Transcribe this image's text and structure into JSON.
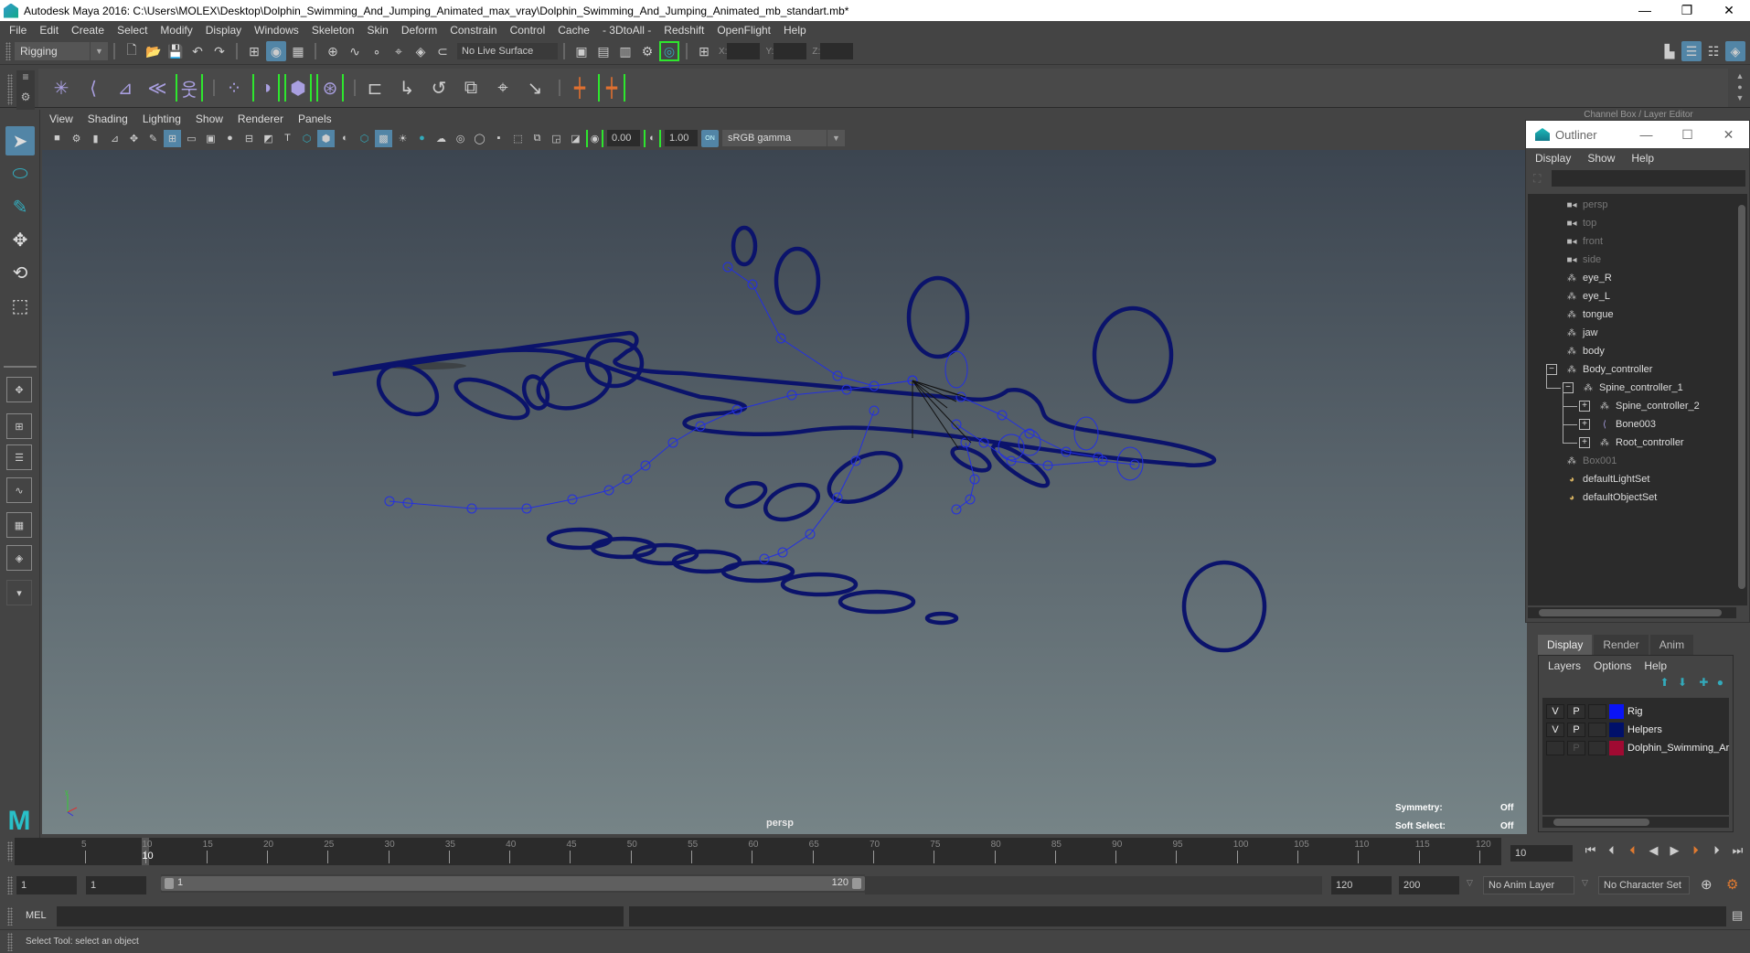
{
  "window": {
    "title": "Autodesk Maya 2016: C:\\Users\\MOLEX\\Desktop\\Dolphin_Swimming_And_Jumping_Animated_max_vray\\Dolphin_Swimming_And_Jumping_Animated_mb_standart.mb*",
    "minimize": "—",
    "restore": "❐",
    "close": "✕"
  },
  "menubar": [
    "File",
    "Edit",
    "Create",
    "Select",
    "Modify",
    "Display",
    "Windows",
    "Skeleton",
    "Skin",
    "Deform",
    "Constrain",
    "Control",
    "Cache",
    "- 3DtoAll -",
    "Redshift",
    "OpenFlight",
    "Help"
  ],
  "statusline": {
    "menuset": "Rigging",
    "live_surface": "No Live Surface",
    "x_label": "X:",
    "y_label": "Y:",
    "z_label": "Z:",
    "x_value": "",
    "y_value": "",
    "z_value": ""
  },
  "shelf": {
    "tools": [
      "joint-tool",
      "ik-handle",
      "ik-spline",
      "insert-joint",
      "hik-skeleton",
      "paint-weights",
      "bind-skin",
      "lattice",
      "cluster",
      "parent-constraint",
      "point-constraint",
      "orient-constraint",
      "scale-constraint",
      "aim-constraint",
      "pole-vector",
      "set-driven-key",
      "set-key-with-link"
    ]
  },
  "viewport": {
    "menus": [
      "View",
      "Shading",
      "Lighting",
      "Show",
      "Renderer",
      "Panels"
    ],
    "exposure": "0.00",
    "gamma": "1.00",
    "color_mgmt_badge": "ON",
    "color_space": "sRGB gamma",
    "camera": "persp",
    "symmetry_label": "Symmetry:",
    "symmetry_value": "Off",
    "soft_select_label": "Soft Select:",
    "soft_select_value": "Off",
    "colors": {
      "controls": "#0b136b",
      "joints": "#2430e0"
    }
  },
  "channel_box": {
    "title": "Channel Box / Layer Editor"
  },
  "outliner": {
    "title": "Outliner",
    "menus": [
      "Display",
      "Show",
      "Help"
    ],
    "items": [
      {
        "label": "persp",
        "icon": "camera-icon",
        "dim": true,
        "depth": 0
      },
      {
        "label": "top",
        "icon": "camera-icon",
        "dim": true,
        "depth": 0
      },
      {
        "label": "front",
        "icon": "camera-icon",
        "dim": true,
        "depth": 0
      },
      {
        "label": "side",
        "icon": "camera-icon",
        "dim": true,
        "depth": 0
      },
      {
        "label": "eye_R",
        "icon": "transform-icon",
        "dim": false,
        "depth": 0
      },
      {
        "label": "eye_L",
        "icon": "transform-icon",
        "dim": false,
        "depth": 0
      },
      {
        "label": "tongue",
        "icon": "transform-icon",
        "dim": false,
        "depth": 0
      },
      {
        "label": "jaw",
        "icon": "transform-icon",
        "dim": false,
        "depth": 0
      },
      {
        "label": "body",
        "icon": "transform-icon",
        "dim": false,
        "depth": 0
      },
      {
        "label": "Body_controller",
        "icon": "transform-icon",
        "dim": false,
        "depth": 0,
        "expander": "−"
      },
      {
        "label": "Spine_controller_1",
        "icon": "transform-icon",
        "dim": false,
        "depth": 1,
        "expander": "−"
      },
      {
        "label": "Spine_controller_2",
        "icon": "transform-icon",
        "dim": false,
        "depth": 2,
        "expander": "+"
      },
      {
        "label": "Bone003",
        "icon": "joint-icon",
        "dim": false,
        "depth": 2,
        "expander": "+"
      },
      {
        "label": "Root_controller",
        "icon": "transform-icon",
        "dim": false,
        "depth": 2,
        "expander": "+"
      },
      {
        "label": "Box001",
        "icon": "transform-icon",
        "dim": true,
        "depth": 0
      },
      {
        "label": "defaultLightSet",
        "icon": "set-icon",
        "dim": false,
        "depth": 0
      },
      {
        "label": "defaultObjectSet",
        "icon": "set-icon",
        "dim": false,
        "depth": 0
      }
    ]
  },
  "layer_editor": {
    "tabs": [
      "Display",
      "Render",
      "Anim"
    ],
    "active_tab": "Display",
    "menus": [
      "Layers",
      "Options",
      "Help"
    ],
    "layers": [
      {
        "v": "V",
        "p": "P",
        "name": "Rig",
        "color": "#0a14f5"
      },
      {
        "v": "V",
        "p": "P",
        "name": "Helpers",
        "color": "#00106a"
      },
      {
        "v": "",
        "p": "P",
        "name": "Dolphin_Swimming_Ar",
        "color": "#a00a32"
      }
    ]
  },
  "timeline": {
    "start": 1,
    "end": 120,
    "tick_labels": [
      "5",
      "10",
      "15",
      "20",
      "25",
      "30",
      "35",
      "40",
      "45",
      "50",
      "55",
      "60",
      "65",
      "70",
      "75",
      "80",
      "85",
      "90",
      "95",
      "100",
      "105",
      "110",
      "115",
      "120"
    ],
    "current_frame": "10",
    "current_frame_field": "10"
  },
  "range": {
    "start_field": "1",
    "playback_start_field": "1",
    "slider_start": "1",
    "slider_end": "120",
    "playback_end_field": "120",
    "end_field": "200",
    "anim_layer": "No Anim Layer",
    "character_set": "No Character Set"
  },
  "command_line": {
    "label": "MEL",
    "value": "",
    "result": ""
  },
  "help_line": "Select Tool: select an object"
}
